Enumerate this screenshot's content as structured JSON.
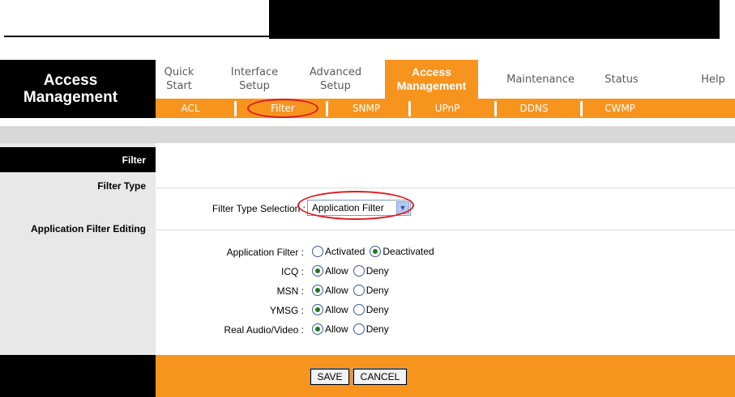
{
  "brand": {
    "line1": "Access",
    "line2": "Management"
  },
  "nav": [
    {
      "label": "Quick Start",
      "active": false
    },
    {
      "label": "Interface Setup",
      "active": false
    },
    {
      "label": "Advanced Setup",
      "active": false
    },
    {
      "label": "Access Management",
      "active": true
    },
    {
      "label": "Maintenance",
      "active": false
    },
    {
      "label": "Status",
      "active": false
    },
    {
      "label": "Help",
      "active": false
    }
  ],
  "subnav": [
    "ACL",
    "Filter",
    "SNMP",
    "UPnP",
    "DDNS",
    "CWMP"
  ],
  "subnav_selected": "Filter",
  "sections": {
    "filter": "Filter",
    "filter_type": "Filter Type",
    "app_filter_editing": "Application Filter Editing"
  },
  "filter_type": {
    "label": "Filter Type Selection :",
    "value": "Application Filter"
  },
  "app_filter": {
    "label": "Application Filter :",
    "options": [
      "Activated",
      "Deactivated"
    ],
    "selected": "Deactivated"
  },
  "apps": [
    {
      "label": "ICQ :",
      "options": [
        "Allow",
        "Deny"
      ],
      "selected": "Allow"
    },
    {
      "label": "MSN :",
      "options": [
        "Allow",
        "Deny"
      ],
      "selected": "Allow"
    },
    {
      "label": "YMSG :",
      "options": [
        "Allow",
        "Deny"
      ],
      "selected": "Allow"
    },
    {
      "label": "Real Audio/Video :",
      "options": [
        "Allow",
        "Deny"
      ],
      "selected": "Allow"
    }
  ],
  "buttons": {
    "save": "SAVE",
    "cancel": "CANCEL"
  },
  "colors": {
    "accent": "#f7941e",
    "highlight_circle": "#e0191e"
  }
}
